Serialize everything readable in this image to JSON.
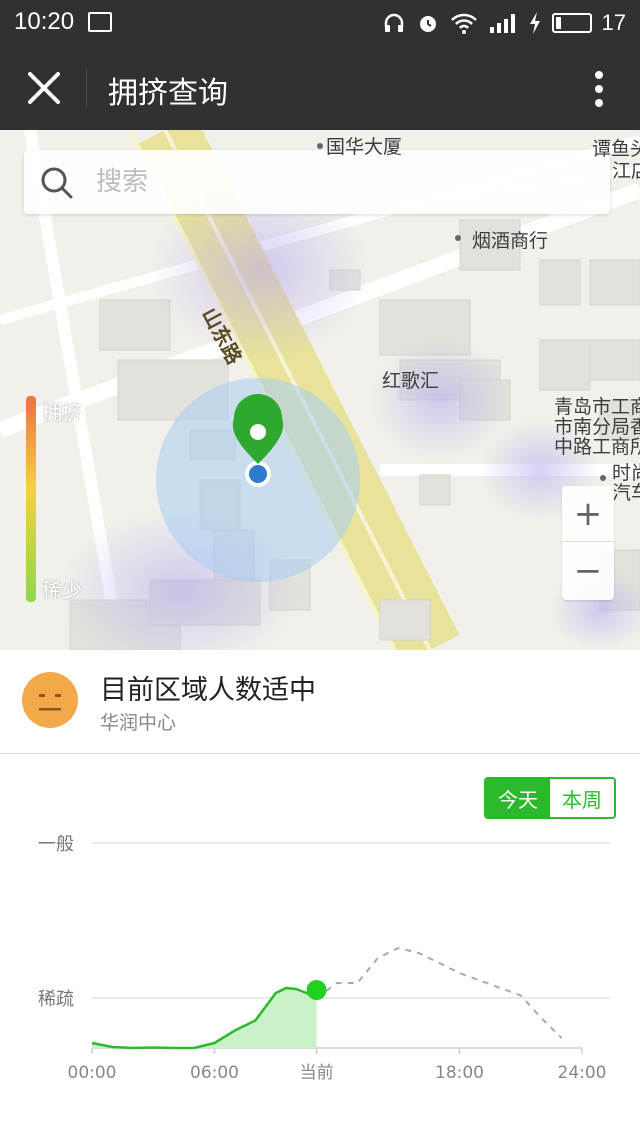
{
  "status_bar": {
    "time": "10:20",
    "battery_level": "17"
  },
  "titlebar": {
    "title": "拥挤查询"
  },
  "map": {
    "search_placeholder": "搜索",
    "legend": {
      "high": "拥挤",
      "low": "稀少"
    },
    "zoom_in": "+",
    "zoom_out": "−",
    "labels": {
      "guohua": "国华大厦",
      "tanyu": "谭鱼头",
      "jiangdian": "江店",
      "yanjiu": "烟酒商行",
      "shandonglu": "山东路",
      "hongge": "红歌汇",
      "qingdao1": "青岛市工商",
      "qingdao2": "市南分局香",
      "qingdao3": "中路工商所",
      "shishang1": "时尚",
      "shishang2": "汽车"
    }
  },
  "status": {
    "headline": "目前区域人数适中",
    "place": "华润中心"
  },
  "chart": {
    "tabs": {
      "today": "今天",
      "week": "本周"
    },
    "accent": "#2cba2c"
  },
  "chart_data": {
    "type": "area",
    "y_levels": [
      "稀疏",
      "一般"
    ],
    "x_ticks": [
      "00:00",
      "06:00",
      "当前",
      "18:00",
      "24:00"
    ],
    "current_hour": 11,
    "series": [
      {
        "kind": "actual",
        "x": [
          0,
          1,
          2,
          3,
          4,
          5,
          6,
          7,
          8,
          9,
          9.5,
          10,
          10.5,
          11
        ],
        "y": [
          0.1,
          0.02,
          0.0,
          0.01,
          0.0,
          0.0,
          0.1,
          0.35,
          0.55,
          1.1,
          1.2,
          1.18,
          1.1,
          1.0
        ]
      },
      {
        "kind": "forecast",
        "x": [
          11,
          12,
          13,
          14,
          15,
          16,
          17,
          18,
          19,
          20,
          21,
          22,
          23
        ],
        "y": [
          1.0,
          1.3,
          1.3,
          1.8,
          2.0,
          1.9,
          1.7,
          1.5,
          1.35,
          1.2,
          1.05,
          0.6,
          0.2
        ]
      }
    ]
  }
}
